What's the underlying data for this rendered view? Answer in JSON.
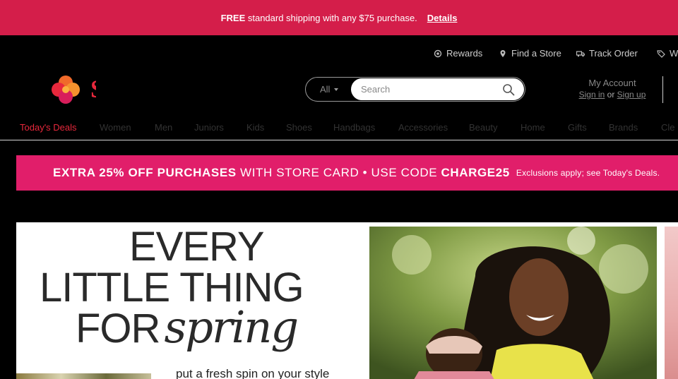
{
  "promo": {
    "free": "FREE",
    "text": "standard shipping with any $75 purchase.",
    "details": "Details"
  },
  "utility": {
    "rewards": "Rewards",
    "find_store": "Find a Store",
    "track_order": "Track Order",
    "wish_partial": "W"
  },
  "search": {
    "scope": "All",
    "placeholder": "Search"
  },
  "account": {
    "title": "My Account",
    "sign_in": "Sign in",
    "or": "or",
    "sign_up": "Sign up"
  },
  "nav": [
    "Today's Deals",
    "Women",
    "Men",
    "Juniors",
    "Kids",
    "Shoes",
    "Handbags",
    "Accessories",
    "Beauty",
    "Home",
    "Gifts",
    "Brands",
    "Cle"
  ],
  "card_banner": {
    "part1": "EXTRA 25% OFF PURCHASES",
    "part2": "WITH STORE CARD • USE CODE",
    "code": "CHARGE25",
    "note": "Exclusions apply; see Today's Deals."
  },
  "hero": {
    "line1": "EVERY",
    "line2": "LITTLE THING",
    "line3": "FOR",
    "script": "spring",
    "sub": "put a fresh spin on your style"
  },
  "colors": {
    "promo_bg": "#d41e4a",
    "card_banner_bg": "#e11e6a",
    "deal_red": "#e8283c"
  }
}
